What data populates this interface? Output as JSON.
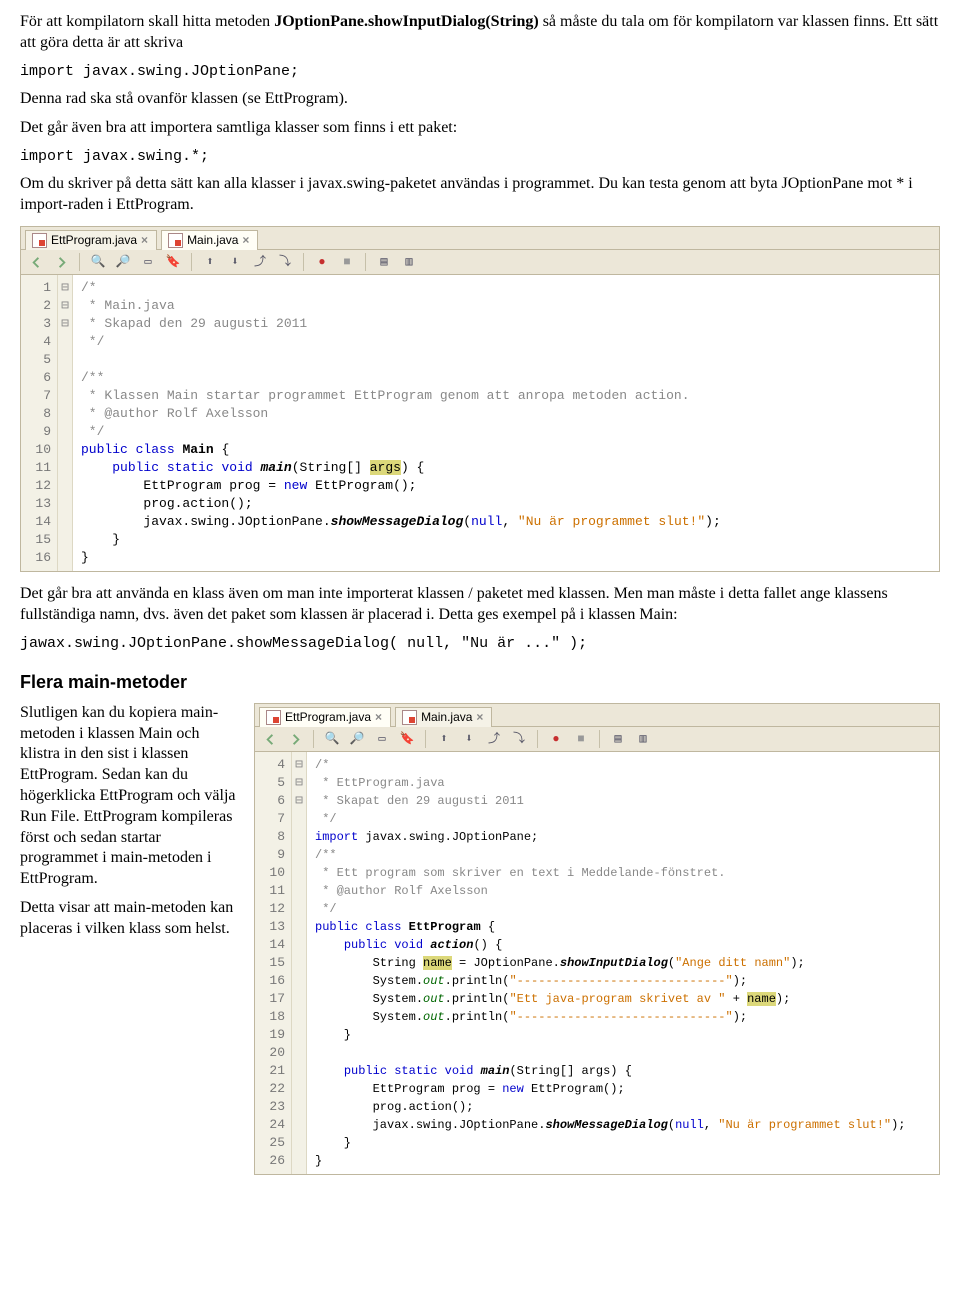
{
  "para1_a": "För att kompilatorn skall hitta metoden ",
  "para1_b": "JOptionPane.showInputDialog(String)",
  "para1_c": " så måste du tala om för kompilatorn var klassen finns. Ett sätt att göra detta är att skriva",
  "code1": "import javax.swing.JOptionPane;",
  "para2": "Denna rad ska stå ovanför klassen (se EttProgram).",
  "para3": "Det går även bra att importera samtliga klasser som finns i ett paket:",
  "code2": "import javax.swing.*;",
  "para4": "Om du skriver på detta sätt kan alla klasser i javax.swing-paketet användas i programmet. Du kan testa genom att byta JOptionPane mot * i import-raden i EttProgram.",
  "ide1": {
    "tabs": [
      {
        "label": "EttProgram.java",
        "active": false
      },
      {
        "label": "Main.java",
        "active": true
      }
    ],
    "lines": [
      "1",
      "2",
      "3",
      "4",
      "5",
      "6",
      "7",
      "8",
      "9",
      "10",
      "11",
      "12",
      "13",
      "14",
      "15",
      "16"
    ]
  },
  "src1": {
    "c1": "/*",
    "c2": " * Main.java",
    "c3": " * Skapad den 29 augusti 2011",
    "c4": " */",
    "c5": "/**",
    "c6": " * Klassen Main startar programmet EttProgram genom att anropa metoden action.",
    "c7": " * @author Rolf Axelsson",
    "c8": " */",
    "k_public": "public",
    "k_class": "class",
    "cls_main": "Main",
    "k_static": "static",
    "k_void": "void",
    "mth_main": "main",
    "sig1": "(String[] ",
    "arg": "args",
    "sig2": ") {",
    "line12a": "EttProgram prog = ",
    "k_new": "new",
    "line12b": " EttProgram();",
    "line13": "prog.action();",
    "line14a": "javax.swing.JOptionPane.",
    "line14b": "showMessageDialog",
    "line14c": "(",
    "k_null": "null",
    "line14d": ", ",
    "str1": "\"Nu är programmet slut!\"",
    "line14e": ");"
  },
  "para5": "Det går bra att använda en klass även om man inte importerat klassen / paketet med klassen. Men man måste i detta fallet ange klassens fullständiga namn, dvs. även det paket som klassen är placerad i. Detta ges exempel på i klassen Main:",
  "code3": "jawax.swing.JOptionPane.showMessageDialog( null, \"Nu är ...\" );",
  "heading2": "Flera main-metoder",
  "para6": "Slutligen kan du kopiera main-metoden i klassen Main och klistra in den sist i klassen EttProgram. Sedan kan du högerklicka EttProgram och välja Run File. EttProgram kompileras först och sedan startar programmet i main-metoden i EttProgram.",
  "para7": "Detta visar att main-metoden kan placeras i vilken klass som helst.",
  "ide2": {
    "tabs": [
      {
        "label": "EttProgram.java",
        "active": true
      },
      {
        "label": "Main.java",
        "active": false
      }
    ],
    "lines": [
      "4",
      "5",
      "6",
      "7",
      "8",
      "9",
      "10",
      "11",
      "12",
      "13",
      "14",
      "15",
      "16",
      "17",
      "18",
      "19",
      "20",
      "21",
      "22",
      "23",
      "24",
      "25",
      "26"
    ]
  },
  "src2": {
    "c1": "/*",
    "c2": " * EttProgram.java",
    "c3": " * Skapat den 29 augusti 2011",
    "c4": " */",
    "imp1": "import",
    "imp2": " javax.swing.JOptionPane;",
    "c5": "/**",
    "c6": " * Ett program som skriver en text i Meddelande-fönstret.",
    "c7": " * @author Rolf Axelsson",
    "c8": " */",
    "cls": "EttProgram",
    "mth_action": "action",
    "line15a": "String ",
    "name": "name",
    "line15b": " = JOptionPane.",
    "line15c": "showInputDialog",
    "line15d": "(",
    "str15": "\"Ange ditt namn\"",
    "line15e": ");",
    "sys": "System.",
    "out": "out",
    "println": ".println(",
    "str16": "\"-----------------------------\"",
    "str17a": "\"Ett java-program skrivet av \"",
    "plus": " + ",
    "str18": "\"-----------------------------\"",
    "line22a": "EttProgram prog = ",
    "line22b": " EttProgram();",
    "line23": "prog.action();",
    "line24a": "javax.swing.JOptionPane.",
    "line24b": "showMessageDialog",
    "str24": "\"Nu är programmet slut!\"",
    "close": ");"
  }
}
